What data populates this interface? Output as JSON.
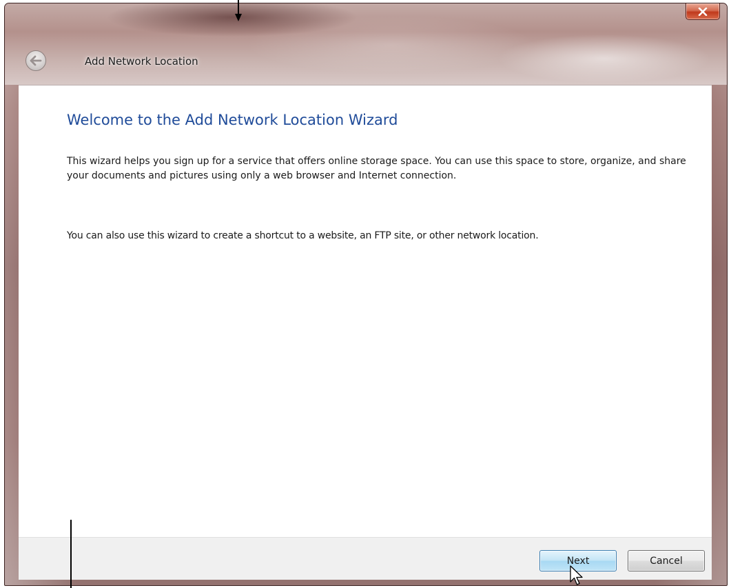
{
  "window": {
    "title": "Add Network Location"
  },
  "titlebar": {
    "back_icon": "back-arrow-icon",
    "close_icon": "close-x-icon"
  },
  "content": {
    "heading": "Welcome to the Add Network Location Wizard",
    "paragraph_1": "This wizard helps you sign up for a service that offers online storage space.  You can use this space to store, organize, and share your documents and pictures using only a web browser and Internet connection.",
    "paragraph_2": "You can also use this wizard to create a shortcut to a website, an FTP site, or other network location."
  },
  "footer": {
    "next_label": "Next",
    "cancel_label": "Cancel"
  },
  "colors": {
    "heading": "#1f4b99",
    "frame": "#7b4b47",
    "close_button": "#c0391c"
  }
}
